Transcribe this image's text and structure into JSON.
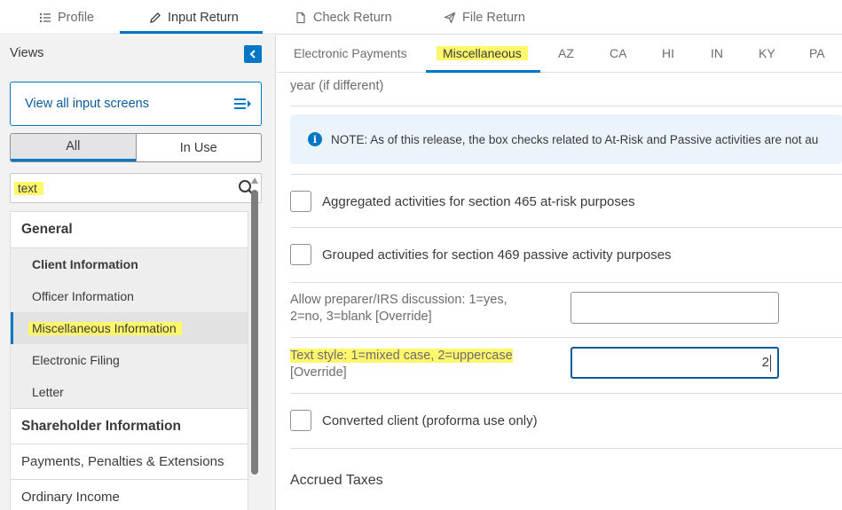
{
  "top_tabs": [
    {
      "label": "Profile",
      "icon": "list-icon"
    },
    {
      "label": "Input Return",
      "icon": "pencil-icon"
    },
    {
      "label": "Check Return",
      "icon": "document-icon"
    },
    {
      "label": "File Return",
      "icon": "send-icon"
    }
  ],
  "sidebar": {
    "views_label": "Views",
    "view_all_label": "View all input screens",
    "filter": {
      "all": "All",
      "in_use": "In Use"
    },
    "search_value": "text",
    "groups": {
      "general": "General",
      "items": [
        "Client Information",
        "Officer Information",
        "Miscellaneous Information",
        "Electronic Filing",
        "Letter"
      ],
      "shareholder": "Shareholder Information",
      "payments": "Payments, Penalties & Extensions",
      "ordinary": "Ordinary Income"
    }
  },
  "main": {
    "sub_tabs": [
      "Electronic Payments",
      "Miscellaneous",
      "AZ",
      "CA",
      "HI",
      "IN",
      "KY",
      "PA"
    ],
    "fragment_text": "year (if different)",
    "note": "NOTE: As of this release, the box checks related to At-Risk and Passive activities are not au",
    "checkbox_aggregated": "Aggregated activities for section 465 at-risk purposes",
    "checkbox_grouped": "Grouped activities for section 469 passive activity purposes",
    "preparer_label_1": "Allow preparer/IRS discussion: 1=yes,",
    "preparer_label_2": "2=no, 3=blank [Override]",
    "preparer_value": "",
    "text_style_label_1": "Text style: 1=mixed case, 2=uppercase",
    "text_style_label_2": "[Override]",
    "text_style_value": "2",
    "checkbox_converted": "Converted client (proforma use only)",
    "section_accrued": "Accrued Taxes"
  },
  "colors": {
    "accent": "#0077c5",
    "highlight": "#fff86a",
    "note_bg": "#ebf4fa"
  }
}
